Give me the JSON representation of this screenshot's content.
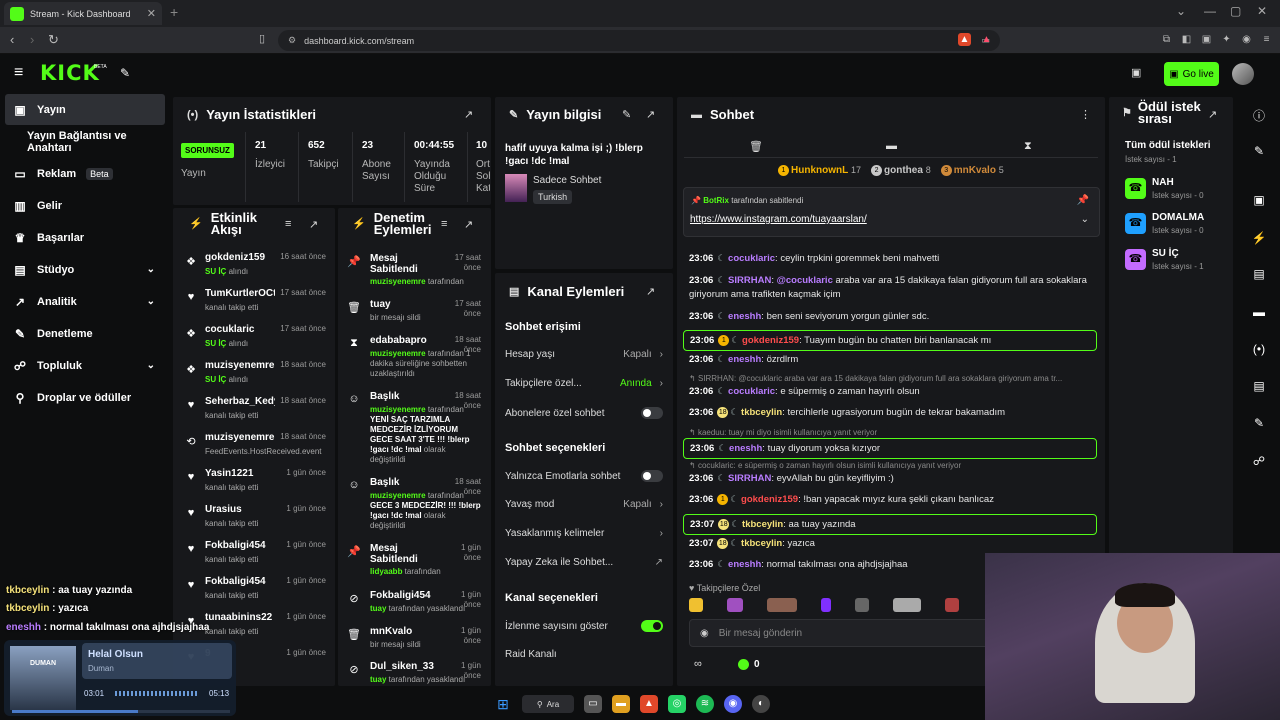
{
  "browser": {
    "tab_title": "Stream - Kick Dashboard",
    "url": "dashboard.kick.com/stream"
  },
  "header": {
    "logo": "KICK",
    "beta": "BETA",
    "go_live": "Go live"
  },
  "sidebar": {
    "items": [
      {
        "label": "Yayın",
        "icon": "broadcast-icon"
      },
      {
        "label": "Yayın Bağlantısı ve Anahtarı",
        "icon": ""
      },
      {
        "label": "Reklam",
        "icon": "monitor-icon",
        "badge": "Beta"
      },
      {
        "label": "Gelir",
        "icon": "chart-icon"
      },
      {
        "label": "Başarılar",
        "icon": "trophy-icon"
      },
      {
        "label": "Stüdyo",
        "icon": "layout-icon"
      },
      {
        "label": "Analitik",
        "icon": "analytics-icon"
      },
      {
        "label": "Denetleme",
        "icon": "wrench-icon"
      },
      {
        "label": "Topluluk",
        "icon": "community-icon"
      },
      {
        "label": "Droplar ve ödüller",
        "icon": "gift-icon"
      }
    ]
  },
  "stats": {
    "title": "Yayın İstatistikleri",
    "status": "SORUNSUZ",
    "status_label": "Yayın",
    "cols": [
      {
        "value": "21",
        "label": "İzleyici"
      },
      {
        "value": "652",
        "label": "Takipçi"
      },
      {
        "value": "23",
        "label": "Abone Sayısı"
      },
      {
        "value": "00:44:55",
        "label": "Yayında Olduğu Süre"
      },
      {
        "value": "10",
        "label": "Ort Soh Kat"
      }
    ]
  },
  "stream_info": {
    "title": "Yayın bilgisi",
    "stream_title": "hafif uyuya kalma işi ;) !blerp !gacı !dc !mal",
    "category": "Sadece Sohbet",
    "language": "Turkish"
  },
  "activity": {
    "title": "Etkinlik Akışı",
    "items": [
      {
        "icon": "gift-sub-icon",
        "name": "gokdeniz159",
        "time": "16 saat önce",
        "sub": "SU İÇ alındı",
        "green": "SU İÇ"
      },
      {
        "icon": "heart-icon",
        "name": "TumKurtlerOCtur",
        "time": "17 saat önce",
        "sub": "kanalı takip etti"
      },
      {
        "icon": "gift-sub-icon",
        "name": "cocuklaric",
        "time": "17 saat önce",
        "sub": "SU İÇ alındı",
        "green": "SU İÇ"
      },
      {
        "icon": "gift-sub-icon",
        "name": "muzisyenemre",
        "time": "18 saat önce",
        "sub": "SU İÇ alındı",
        "green": "SU İÇ"
      },
      {
        "icon": "heart-icon",
        "name": "Seherbaz_Kedy",
        "time": "18 saat önce",
        "sub": "kanalı takip etti"
      },
      {
        "icon": "host-icon",
        "name": "muzisyenemre",
        "time": "18 saat önce",
        "sub": "FeedEvents.HostReceived.event"
      },
      {
        "icon": "heart-icon",
        "name": "Yasin1221",
        "time": "1 gün önce",
        "sub": "kanalı takip etti"
      },
      {
        "icon": "heart-icon",
        "name": "Urasius",
        "time": "1 gün önce",
        "sub": "kanalı takip etti"
      },
      {
        "icon": "heart-icon",
        "name": "Fokbaligi454",
        "time": "1 gün önce",
        "sub": "kanalı takip etti"
      },
      {
        "icon": "heart-icon",
        "name": "Fokbaligi454",
        "time": "1 gün önce",
        "sub": "kanalı takip etti"
      },
      {
        "icon": "heart-icon",
        "name": "tunaabinins22",
        "time": "1 gün önce",
        "sub": "kanalı takip etti"
      },
      {
        "icon": "heart-icon",
        "name": "9",
        "time": "1 gün önce",
        "sub": ""
      }
    ]
  },
  "moderation": {
    "title": "Denetim Eylemleri",
    "items": [
      {
        "icon": "pin-icon",
        "name": "Mesaj Sabitlendi",
        "time": "17 saat önce",
        "green": "muzisyenemre",
        "rest": " tarafından"
      },
      {
        "icon": "trash-icon",
        "name": "tuay",
        "time": "17 saat önce",
        "green": "",
        "rest": "bir mesajı sildi"
      },
      {
        "icon": "hourglass-icon",
        "name": "edababapro",
        "time": "18 saat önce",
        "green": "muzisyenemre",
        "rest": " tarafından 1 dakika süreliğine sohbetten uzaklaştırıldı"
      },
      {
        "icon": "user-card-icon",
        "name": "Başlık",
        "time": "18 saat önce",
        "green": "muzisyenemre",
        "rest": " tarafından",
        "bold": "YENİ SAÇ TARZIMLA MEDCEZİR İZLİYORUM GECE SAAT 3'TE !!! !blerp !gacı !dc !mal",
        "rest2": " olarak değiştirildi"
      },
      {
        "icon": "user-card-icon",
        "name": "Başlık",
        "time": "18 saat önce",
        "green": "muzisyenemre",
        "rest": " tarafından",
        "bold": "GECE 3 MEDCEZİR! !!! !blerp !gacı !dc !mal",
        "rest2": " olarak değiştirildi"
      },
      {
        "icon": "pin-icon",
        "name": "Mesaj Sabitlendi",
        "time": "1 gün önce",
        "green": "lidyaabb",
        "rest": " tarafından"
      },
      {
        "icon": "ban-icon",
        "name": "Fokbaligi454",
        "time": "1 gün önce",
        "green": "tuay",
        "rest": " tarafından yasaklandı"
      },
      {
        "icon": "trash-icon",
        "name": "mnKvalo",
        "time": "1 gün önce",
        "green": "",
        "rest": "bir mesajı sildi"
      },
      {
        "icon": "ban-icon",
        "name": "Dul_siken_33",
        "time": "1 gün önce",
        "green": "tuay",
        "rest": " tarafından yasaklandı"
      }
    ]
  },
  "channel_actions": {
    "title": "Kanal Eylemleri",
    "sec1": "Sohbet erişimi",
    "account_age": {
      "label": "Hesap yaşı",
      "value": "Kapalı"
    },
    "followers": {
      "label": "Takipçilere özel...",
      "value": "Anında"
    },
    "subs_only": {
      "label": "Abonelere özel sohbet",
      "on": false
    },
    "sec2": "Sohbet seçenekleri",
    "emotes_only": {
      "label": "Yalnızca Emotlarla sohbet",
      "on": false
    },
    "slow_mode": {
      "label": "Yavaş mod",
      "value": "Kapalı"
    },
    "banned_words": {
      "label": "Yasaklanmış kelimeler"
    },
    "ai_chat": {
      "label": "Yapay Zeka ile Sohbet..."
    },
    "sec3": "Kanal seçenekleri",
    "view_count": {
      "label": "İzlenme sayısını göster",
      "on": true
    },
    "raid": {
      "label": "Raid Kanalı"
    }
  },
  "chat": {
    "title": "Sohbet",
    "leaderboard": [
      {
        "rank": "1",
        "name": "HunknownL",
        "count": "17",
        "color": "#f5b400"
      },
      {
        "rank": "2",
        "name": "gonthea",
        "count": "8",
        "color": "#c8c8c8"
      },
      {
        "rank": "3",
        "name": "mnKvalo",
        "count": "5",
        "color": "#d08a3a"
      }
    ],
    "pinned_by": "BotRix",
    "pinned_suffix": "tarafından sabitlendi",
    "pinned_link": "https://www.instagram.com/tuayaarslan/",
    "messages": [
      {
        "time": "23:06",
        "user": "cocuklaric",
        "color": "#b97dff",
        "text": "ceylin trpkini goremmek beni mahvetti"
      },
      {
        "time": "23:06",
        "user": "SIRRHAN",
        "color": "#b97dff",
        "text": "@cocuklaric araba var ara 15 dakikaya falan gidiyorum full ara sokaklara giriyorum ama trafikten kaçmak içim",
        "mention": "@cocuklaric"
      },
      {
        "time": "23:06",
        "user": "eneshh",
        "color": "#b97dff",
        "text": "ben seni seviyorum yorgun günler sdc."
      },
      {
        "time": "23:06",
        "user": "gokdeniz159",
        "color": "#ff4d4d",
        "text": "Tuayım bugün bu chatten biri banlanacak mı"
      },
      {
        "time": "23:06",
        "user": "eneshh",
        "color": "#b97dff",
        "text": "özrdlrm"
      },
      {
        "time": "23:06",
        "user": "cocuklaric",
        "color": "#b97dff",
        "text": "e süpermiş o zaman hayırlı olsun"
      },
      {
        "time": "23:06",
        "user": "tkbceylin",
        "color": "#f5e27a",
        "text": "tercihlerle ugrasiyorum bugün de tekrar bakamadım"
      },
      {
        "time": "23:06",
        "user": "eneshh",
        "color": "#b97dff",
        "text": "tuay diyorum yoksa kızıyor"
      },
      {
        "time": "23:06",
        "user": "SIRRHAN",
        "color": "#b97dff",
        "text": "eyvAllah bu gün keyifliyim :)"
      },
      {
        "time": "23:06",
        "user": "gokdeniz159",
        "color": "#ff4d4d",
        "text": "!ban yapacak mıyız kura şekli çıkanı banlıcaz"
      },
      {
        "time": "23:07",
        "user": "tkbceylin",
        "color": "#f5e27a",
        "text": "aa tuay yazında"
      },
      {
        "time": "23:07",
        "user": "tkbceylin",
        "color": "#f5e27a",
        "text": "yazıca"
      },
      {
        "time": "23:06",
        "user": "eneshh",
        "color": "#b97dff",
        "text": "normal takılması ona ajhdjsjajhaa"
      }
    ],
    "reply1": "SIRRHAN: @cocuklaric araba var ara 15 dakikaya falan gidiyorum full ara sokaklara giriyorum ama tr...",
    "reply2": "kaeduu: tuay mi diyo isimli kullanıcıya yanıt veriyor",
    "reply3": "cocuklaric: e süpermiş o zaman hayırlı olsun isimli kullanıcıya yanıt veriyor",
    "followers_only": "Takipçilere Özel",
    "placeholder": "Bir mesaj gönderin",
    "count": "0"
  },
  "rewards": {
    "title": "Ödül istek sırası",
    "all": "Tüm ödül istekleri",
    "all_count": "İstek sayısı - 1",
    "items": [
      {
        "name": "NAH",
        "count": "İstek sayısı - 0",
        "color": "#53fc18"
      },
      {
        "name": "DOMALMA",
        "count": "İstek sayısı - 0",
        "color": "#1fa0ff"
      },
      {
        "name": "SU İÇ",
        "count": "İstek sayısı - 1",
        "color": "#c36bff"
      }
    ]
  },
  "overlay": {
    "chat": [
      {
        "user": "tkbceylin",
        "text": " : aa tuay yazında"
      },
      {
        "user": "tkbceylin",
        "text": " : yazıca"
      },
      {
        "user": "eneshh",
        "text": " : normal takılması ona ajhdjsjajhaa"
      }
    ],
    "song": "Helal Olsun",
    "artist": "Duman",
    "album_art": "DUMAN",
    "current": "03:01",
    "total": "05:13",
    "progress": 0.58
  },
  "taskbar": {
    "search": "Ara"
  }
}
